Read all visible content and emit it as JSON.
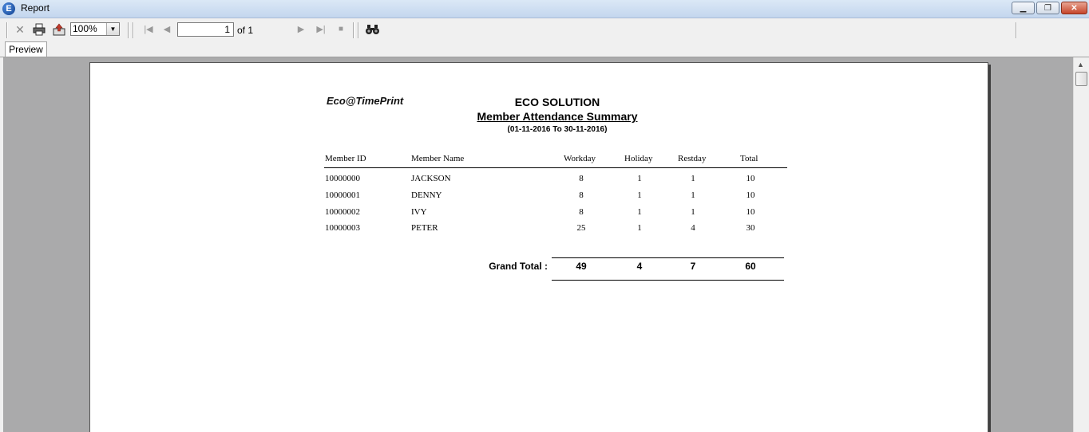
{
  "window": {
    "title": "Report",
    "app_icon_letter": "E"
  },
  "toolbar": {
    "zoom_value": "100%",
    "page_current": "1",
    "page_total_text": "of 1"
  },
  "tabs": [
    {
      "label": "Preview"
    }
  ],
  "report": {
    "brand": "Eco@TimePrint",
    "company": "ECO SOLUTION",
    "title": "Member Attendance Summary",
    "period": "(01-11-2016 To 30-11-2016)",
    "columns": [
      "Member ID",
      "Member Name",
      "Workday",
      "Holiday",
      "Restday",
      "Total"
    ],
    "rows": [
      {
        "id": "10000000",
        "name": "JACKSON",
        "workday": "8",
        "holiday": "1",
        "restday": "1",
        "total": "10"
      },
      {
        "id": "10000001",
        "name": "DENNY",
        "workday": "8",
        "holiday": "1",
        "restday": "1",
        "total": "10"
      },
      {
        "id": "10000002",
        "name": "IVY",
        "workday": "8",
        "holiday": "1",
        "restday": "1",
        "total": "10"
      },
      {
        "id": "10000003",
        "name": "PETER",
        "workday": "25",
        "holiday": "1",
        "restday": "4",
        "total": "30"
      }
    ],
    "grand_total": {
      "label": "Grand Total :",
      "workday": "49",
      "holiday": "4",
      "restday": "7",
      "total": "60"
    }
  }
}
